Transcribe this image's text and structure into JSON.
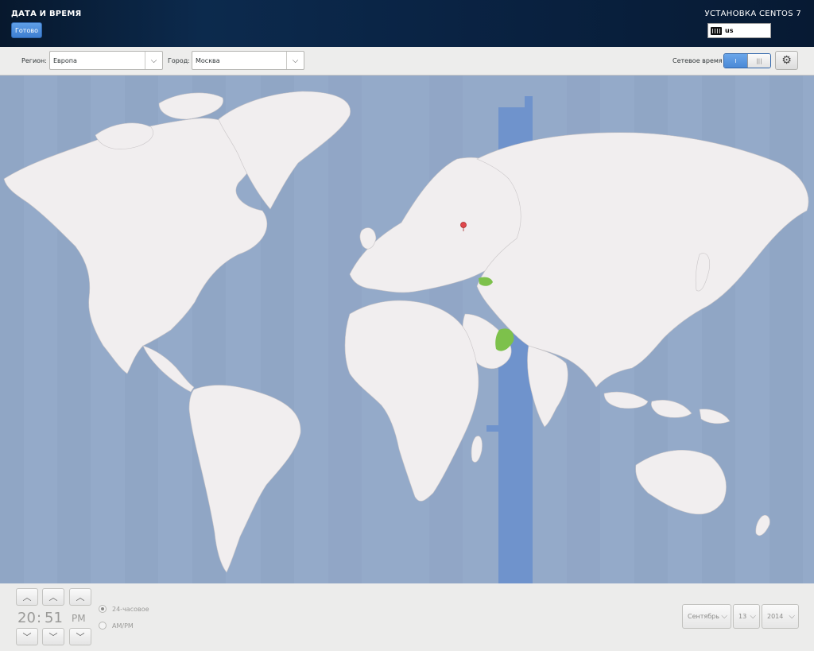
{
  "header": {
    "title": "ДАТА И ВРЕМЯ",
    "done_label": "Готово",
    "product": "УСТАНОВКА CENTOS 7",
    "keyboard_layout": "us"
  },
  "toolbar": {
    "region_label": "Регион:",
    "region_value": "Европа",
    "city_label": "Город:",
    "city_value": "Москва",
    "network_time_label": "Сетевое время",
    "network_time_on": "I",
    "network_time_off": "|||",
    "network_time_enabled": true
  },
  "time": {
    "hours": "20",
    "separator": ":",
    "minutes": "51",
    "ampm": "PM",
    "format_24": "24-часовое",
    "format_ampm": "AM/PM",
    "selected_format": "24-часовое"
  },
  "date": {
    "month": "Сентябрь",
    "day": "13",
    "year": "2014"
  },
  "icons": {
    "keyboard": "keyboard-icon",
    "settings": "gear-icon",
    "up": "chevron-up-icon",
    "down": "chevron-down-icon",
    "location": "map-pin-icon"
  },
  "colors": {
    "ocean": "#94aac9",
    "land": "#f1eeef",
    "timezone_highlight": "#6f93cc",
    "selected_region": "#7dc14b",
    "accent": "#4a89d6"
  }
}
